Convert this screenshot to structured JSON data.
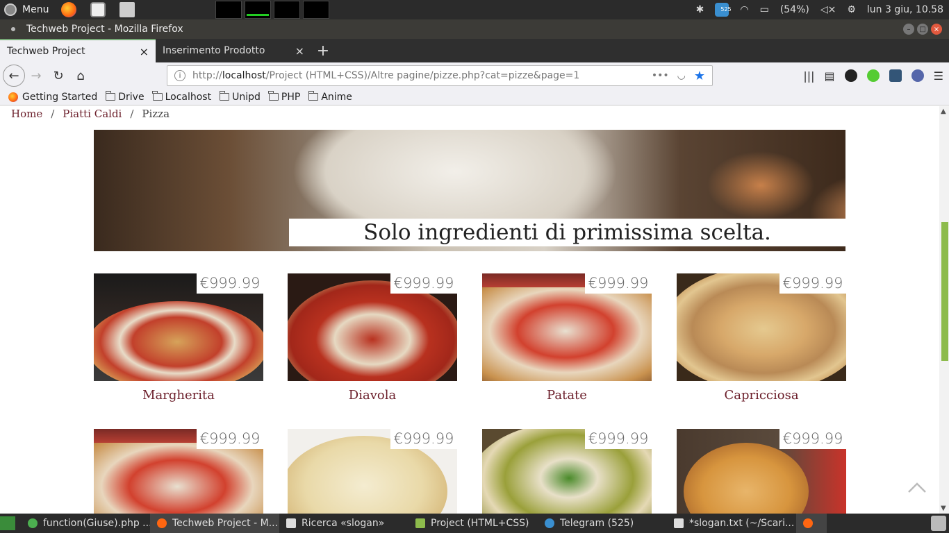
{
  "system_panel": {
    "menu_label": "Menu",
    "telegram_badge": "525",
    "battery": "(54%)",
    "clock": "lun 3 giu, 10.58"
  },
  "window": {
    "title": "Techweb Project - Mozilla Firefox"
  },
  "tabs": [
    {
      "label": "Techweb Project",
      "active": true
    },
    {
      "label": "Inserimento Prodotto",
      "active": false
    }
  ],
  "navbar": {
    "url_prefix": "http://",
    "url_host": "localhost",
    "url_path": "/Project (HTML+CSS)/Altre pagine/pizze.php?cat=pizze&page=1"
  },
  "bookmarks": [
    {
      "label": "Getting Started",
      "icon": "firefox-icon"
    },
    {
      "label": "Drive",
      "icon": "folder-icon"
    },
    {
      "label": "Localhost",
      "icon": "folder-icon"
    },
    {
      "label": "Unipd",
      "icon": "folder-icon"
    },
    {
      "label": "PHP",
      "icon": "folder-icon"
    },
    {
      "label": "Anime",
      "icon": "folder-icon"
    }
  ],
  "breadcrumb": {
    "items": [
      "Home",
      "Piatti Caldi"
    ],
    "current": "Pizza"
  },
  "hero": {
    "caption": "Solo ingredienti di primissima scelta."
  },
  "products": [
    {
      "name": "Margherita",
      "price": "€999.99"
    },
    {
      "name": "Diavola",
      "price": "€999.99"
    },
    {
      "name": "Patate",
      "price": "€999.99"
    },
    {
      "name": "Capricciosa",
      "price": "€999.99"
    },
    {
      "name": "",
      "price": "€999.99"
    },
    {
      "name": "",
      "price": "€999.99"
    },
    {
      "name": "",
      "price": "€999.99"
    },
    {
      "name": "",
      "price": "€999.99"
    }
  ],
  "taskbar": [
    {
      "label": "function(Giuse).php ...",
      "color": "#4caf50"
    },
    {
      "label": "Techweb Project - M...",
      "color": "#ff6611"
    },
    {
      "label": "Ricerca «slogan»",
      "color": "#dddddd"
    },
    {
      "label": "Project (HTML+CSS)",
      "color": "#8dbb4c"
    },
    {
      "label": "Telegram (525)",
      "color": "#3a8fd0"
    },
    {
      "label": "*slogan.txt (~/Scari...",
      "color": "#dddddd"
    }
  ],
  "colors": {
    "accent_link": "#6b1e2a",
    "scroll_thumb": "#8dbb4c",
    "bookmark_star": "#1a73e8"
  }
}
